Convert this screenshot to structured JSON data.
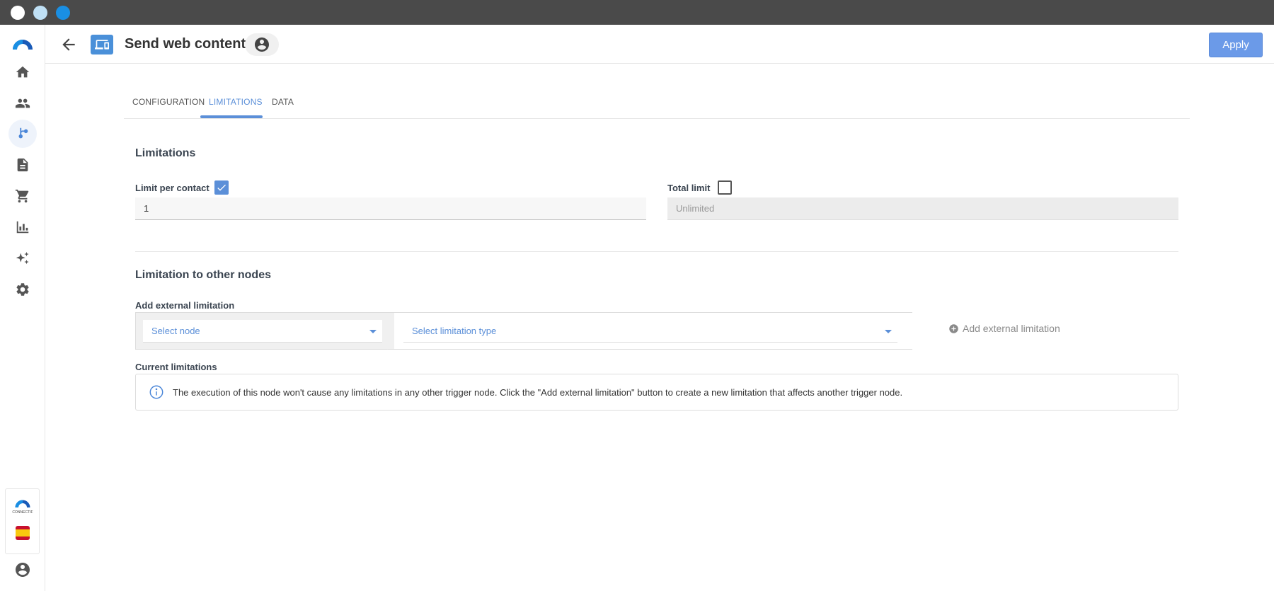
{
  "window": {
    "title_dots": [
      "close",
      "minimize",
      "maximize"
    ]
  },
  "sidebar": {
    "items": [
      {
        "icon": "home-icon"
      },
      {
        "icon": "people-icon"
      },
      {
        "icon": "workflow-icon",
        "active": true
      },
      {
        "icon": "document-icon"
      },
      {
        "icon": "cart-icon"
      },
      {
        "icon": "chart-icon"
      },
      {
        "icon": "sparkle-icon"
      },
      {
        "icon": "gear-icon"
      }
    ],
    "brand_small": "CONNECTIF",
    "language_flag": "es-flag-icon"
  },
  "header": {
    "title": "Send web content",
    "apply_label": "Apply"
  },
  "tabs": [
    {
      "label": "CONFIGURATION"
    },
    {
      "label": "LIMITATIONS",
      "active": true
    },
    {
      "label": "DATA"
    }
  ],
  "limitations": {
    "title": "Limitations",
    "limit_per_contact_label": "Limit per contact",
    "limit_per_contact_checked": true,
    "limit_per_contact_value": "1",
    "total_limit_label": "Total limit",
    "total_limit_checked": false,
    "total_limit_placeholder": "Unlimited"
  },
  "other_nodes": {
    "title": "Limitation to other nodes",
    "add_external_label": "Add external limitation",
    "select_node_placeholder": "Select node",
    "select_type_placeholder": "Select limitation type",
    "add_button_label": "Add external limitation",
    "current_label": "Current limitations",
    "info_text": "The execution of this node won't cause any limitations in any other trigger node. Click the \"Add external limitation\" button to create a new limitation that affects another trigger node."
  },
  "colors": {
    "accent": "#5b8fd8",
    "apply_bg": "#6b9ae8"
  }
}
